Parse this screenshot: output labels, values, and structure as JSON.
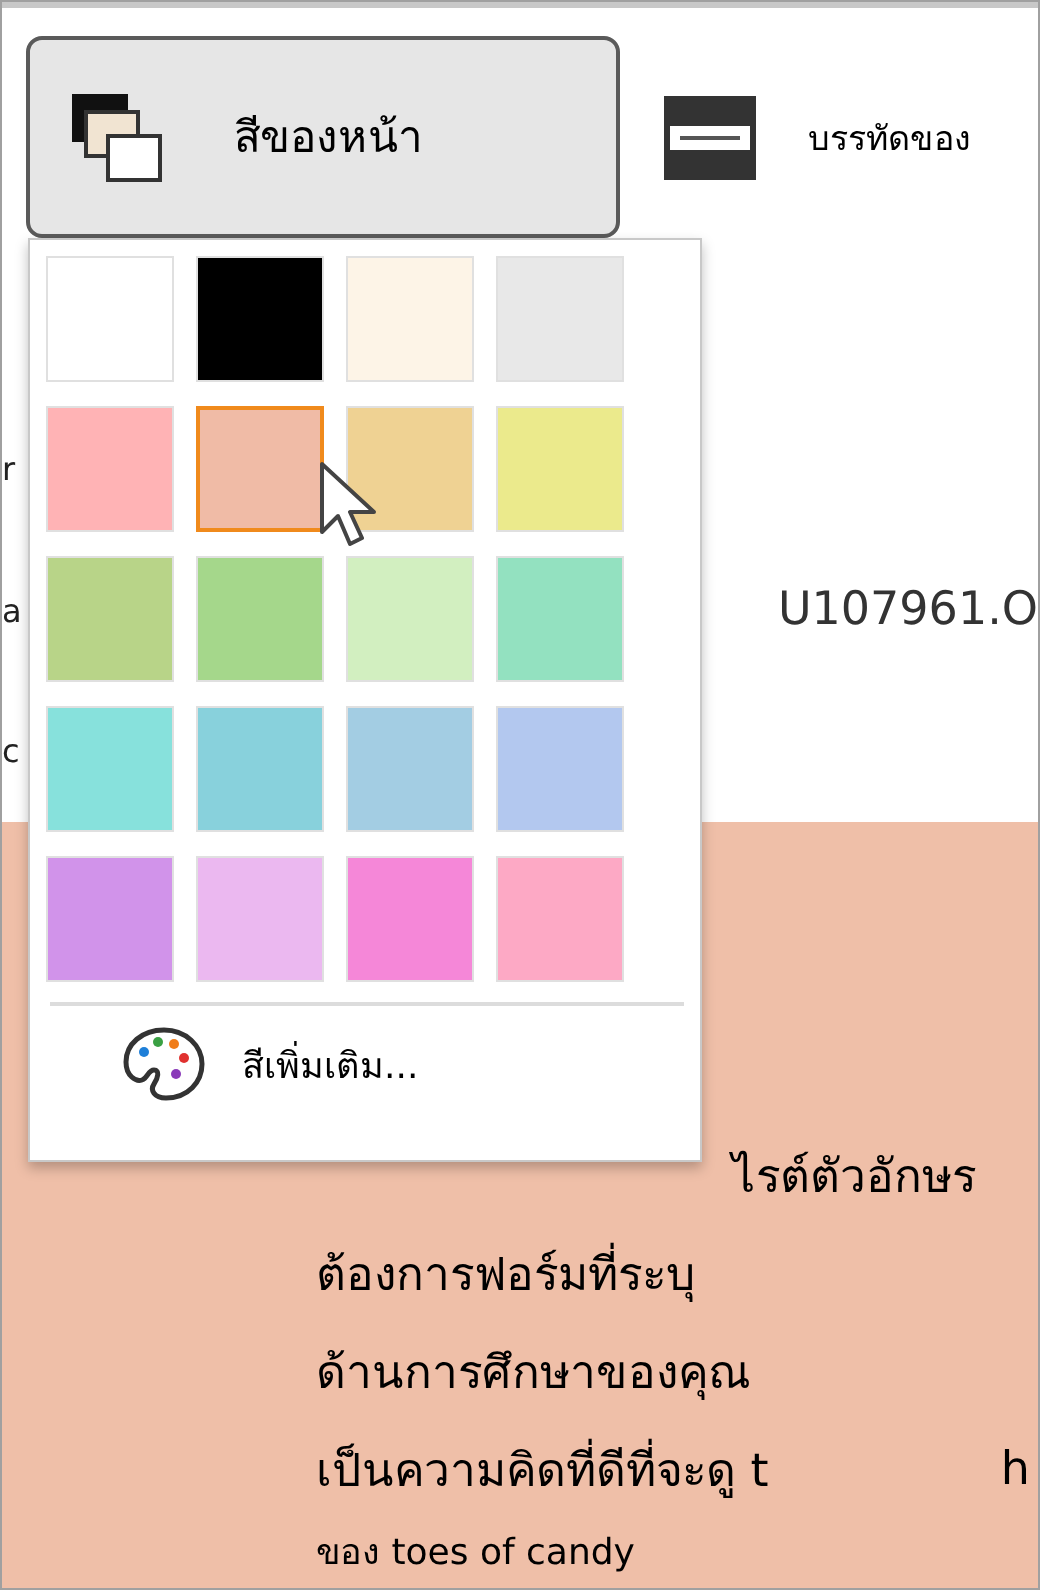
{
  "toolbar": {
    "buttons": [
      {
        "kind": "page-color",
        "label": "สีของหน้า",
        "expanded": true
      },
      {
        "kind": "line",
        "label": "บรรทัดของ"
      }
    ]
  },
  "color_menu": {
    "swatches": [
      {
        "color": "#ffffff",
        "selected": false
      },
      {
        "color": "#000000",
        "selected": false
      },
      {
        "color": "#fdf4e7",
        "selected": false
      },
      {
        "color": "#e8e8e8",
        "selected": false
      },
      {
        "color": "#ffb3b5",
        "selected": false
      },
      {
        "color": "#f0bba6",
        "selected": true
      },
      {
        "color": "#efd293",
        "selected": false
      },
      {
        "color": "#ebea8c",
        "selected": false
      },
      {
        "color": "#b8d488",
        "selected": false
      },
      {
        "color": "#a5d78b",
        "selected": false
      },
      {
        "color": "#d2efc0",
        "selected": false
      },
      {
        "color": "#93e1c0",
        "selected": false
      },
      {
        "color": "#87e1dc",
        "selected": false
      },
      {
        "color": "#88d1dc",
        "selected": false
      },
      {
        "color": "#a3cde3",
        "selected": false
      },
      {
        "color": "#b3c8ef",
        "selected": false
      },
      {
        "color": "#d193ea",
        "selected": false
      },
      {
        "color": "#ebb8f0",
        "selected": false
      },
      {
        "color": "#f587d8",
        "selected": false
      },
      {
        "color": "#fda9c5",
        "selected": false
      }
    ],
    "more_colors": {
      "label": "สีเพิ่มเติม..."
    }
  },
  "document": {
    "edge_letters": [
      "r",
      "a",
      "c"
    ],
    "file_text": "U107961.O",
    "lines": [
      {
        "kind": "continued",
        "parts": [
          "ไรต์ตัวอักษร"
        ]
      },
      {
        "kind": "body",
        "parts": [
          "ต้องการฟอร์มที่ระบุ"
        ]
      },
      {
        "kind": "body",
        "parts": [
          "ด้านการศึกษาของคุณ"
        ]
      },
      {
        "kind": "body",
        "parts": [
          "เป็นความคิดที่ดีที่จะดู t"
        ],
        "trailing": "h"
      },
      {
        "kind": "small",
        "parts": [
          "ของ toes of candy"
        ]
      }
    ]
  }
}
